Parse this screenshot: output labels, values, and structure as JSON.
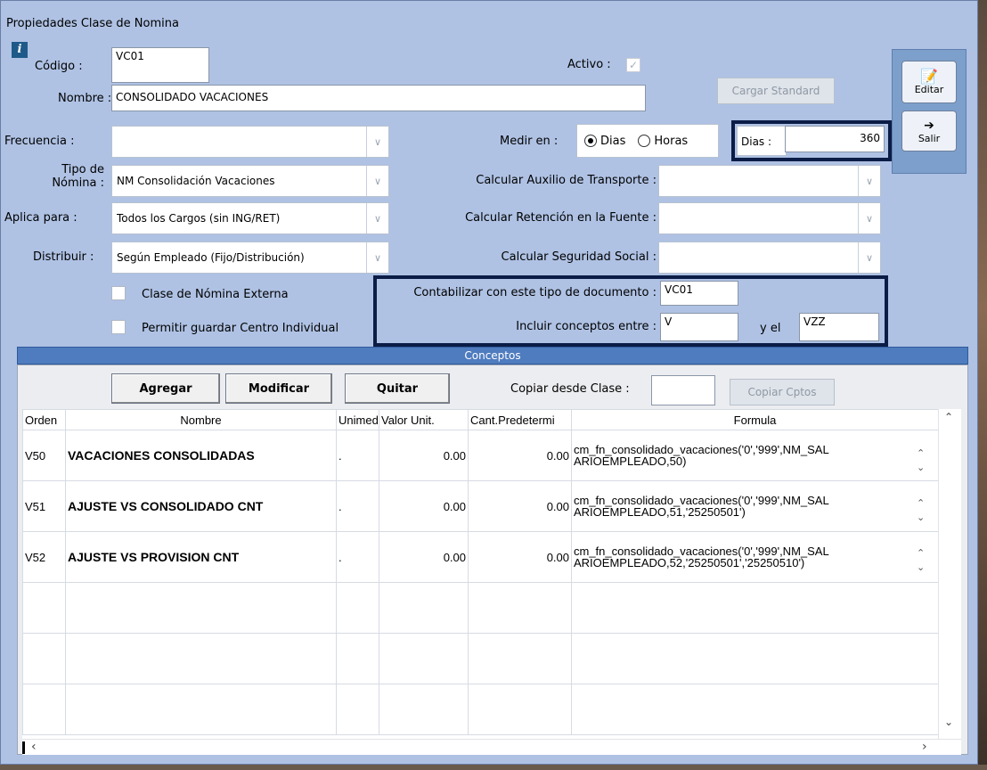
{
  "window": {
    "title": "Propiedades Clase de Nomina"
  },
  "form": {
    "codigo_label": "Código :",
    "codigo_value": "VC01",
    "activo_label": "Activo :",
    "nombre_label": "Nombre :",
    "nombre_value": "CONSOLIDADO VACACIONES",
    "cargar_standard": "Cargar Standard",
    "frecuencia_label": "Frecuencia :",
    "frecuencia_value": "",
    "tipo_nomina_label_1": "Tipo de",
    "tipo_nomina_label_2": "Nómina :",
    "tipo_nomina_value": "NM Consolidación Vacaciones",
    "aplica_label": "Aplica para :",
    "aplica_value": "Todos los Cargos (sin ING/RET)",
    "distribuir_label": "Distribuir :",
    "distribuir_value": "Según Empleado (Fijo/Distribución)",
    "medir_label": "Medir en :",
    "medir_options": [
      "Dias",
      "Horas"
    ],
    "medir_selected": "Dias",
    "dias_label": "Dias :",
    "dias_value": "360",
    "auxilio_label": "Calcular Auxilio de Transporte :",
    "retencion_label": "Calcular Retención en la Fuente :",
    "seguridad_label": "Calcular Seguridad Social :",
    "externa_label": "Clase de Nómina Externa",
    "centro_label": "Permitir guardar Centro Individual",
    "contabilizar_label": "Contabilizar con este tipo de documento :",
    "contabilizar_value": "VC01",
    "incluir_label": "Incluir conceptos entre :",
    "incluir_from": "V",
    "incluir_and_label": "y el",
    "incluir_to": "VZZ"
  },
  "side": {
    "editar": "Editar",
    "salir": "Salir"
  },
  "conceptos": {
    "title": "Conceptos",
    "agregar": "Agregar",
    "modificar": "Modificar",
    "quitar": "Quitar",
    "copiar_label": "Copiar desde Clase :",
    "copiar_value": "",
    "copiar_btn": "Copiar Cptos",
    "columns": [
      "Orden",
      "Nombre",
      "Unimed",
      "Valor Unit.",
      "Cant.Predetermi",
      "Formula"
    ],
    "rows": [
      {
        "orden": "V50",
        "nombre": "VACACIONES CONSOLIDADAS",
        "unimed": ".",
        "valor": "0.00",
        "cant": "0.00",
        "formula_1": "cm_fn_consolidado_vacaciones('0','999',NM_SAL",
        "formula_2": "ARIOEMPLEADO,50)"
      },
      {
        "orden": "V51",
        "nombre": "AJUSTE VS CONSOLIDADO CNT",
        "unimed": ".",
        "valor": "0.00",
        "cant": "0.00",
        "formula_1": "cm_fn_consolidado_vacaciones('0','999',NM_SAL",
        "formula_2": "ARIOEMPLEADO,51,'25250501')"
      },
      {
        "orden": "V52",
        "nombre": "AJUSTE VS PROVISION CNT",
        "unimed": ".",
        "valor": "0.00",
        "cant": "0.00",
        "formula_1": "cm_fn_consolidado_vacaciones('0','999',NM_SAL",
        "formula_2": "ARIOEMPLEADO,52,'25250501','25250510')"
      }
    ]
  },
  "icons": {
    "info": "info-icon",
    "dropdown": "chevron-down-icon",
    "checkmark": "check-icon",
    "editar": "edit-icon",
    "salir": "exit-door-icon"
  },
  "colors": {
    "window_bg": "#afc2e4",
    "highlight_border": "#0b1d46",
    "section_bar": "#4f7cbf"
  }
}
